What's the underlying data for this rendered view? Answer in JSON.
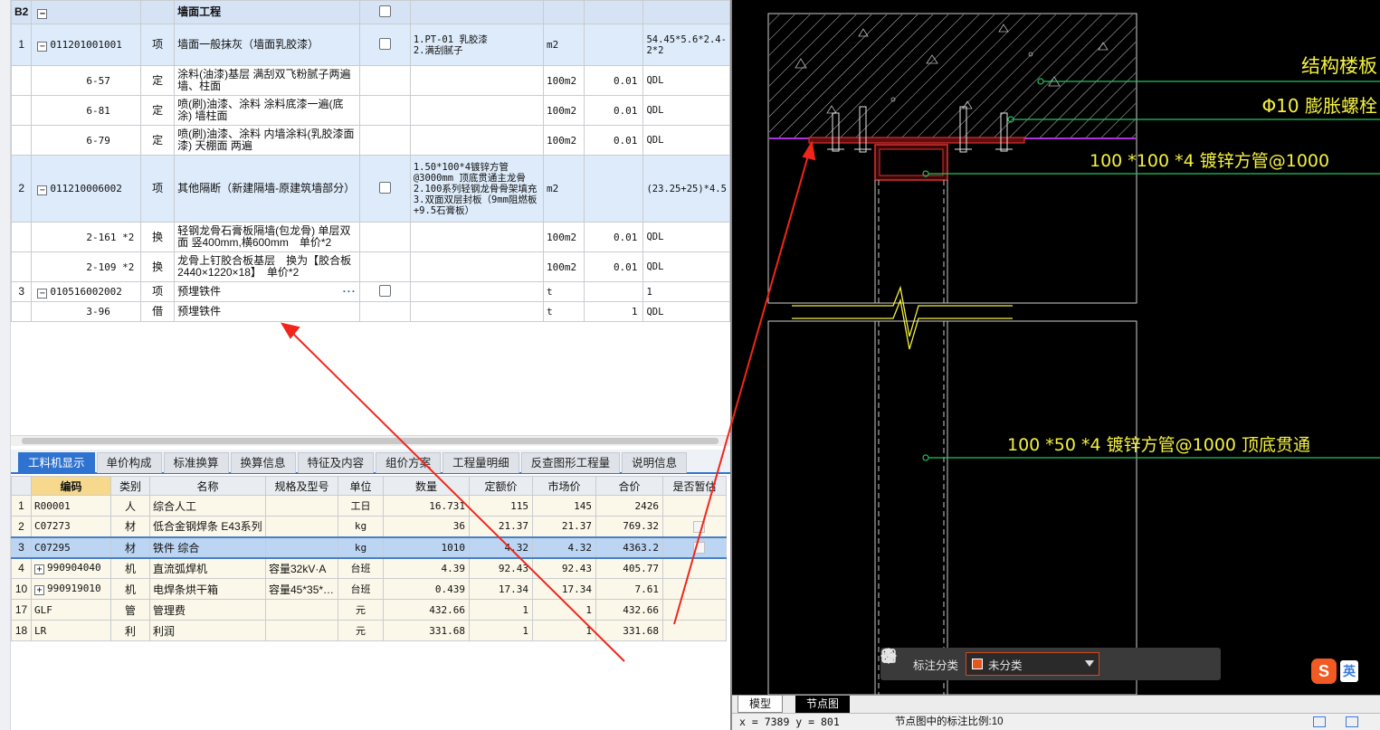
{
  "upper_table": {
    "rows": [
      {
        "kind": "section",
        "idx": "B2",
        "code": "",
        "type": "",
        "name": "墙面工程",
        "feature": "",
        "unit": "",
        "content": "",
        "qty": "",
        "checkbox": true
      },
      {
        "kind": "item",
        "idx": "1",
        "code": "011201001001",
        "type": "项",
        "name": "墙面一般抹灰（墙面乳胶漆）",
        "feature": "1.PT-01 乳胶漆\n2.满刮腻子",
        "unit": "m2",
        "content": "",
        "qty": "54.45*5.6*2.4-2*2",
        "checkbox": true
      },
      {
        "kind": "sub",
        "idx": "",
        "code": "6-57",
        "type": "定",
        "name": "涂料(油漆)基层 满刮双飞粉腻子两遍 墙、柱面",
        "feature": "",
        "unit": "100m2",
        "content": "0.01",
        "qty": "QDL",
        "checkbox": false
      },
      {
        "kind": "sub",
        "idx": "",
        "code": "6-81",
        "type": "定",
        "name": "喷(刷)油漆、涂料 涂料底漆一遍(底涂) 墙柱面",
        "feature": "",
        "unit": "100m2",
        "content": "0.01",
        "qty": "QDL",
        "checkbox": false
      },
      {
        "kind": "sub",
        "idx": "",
        "code": "6-79",
        "type": "定",
        "name": "喷(刷)油漆、涂料 内墙涂料(乳胶漆面漆) 天棚面 两遍",
        "feature": "",
        "unit": "100m2",
        "content": "0.01",
        "qty": "QDL",
        "checkbox": false
      },
      {
        "kind": "item",
        "idx": "2",
        "code": "011210006002",
        "type": "项",
        "name": "其他隔断（新建隔墙-原建筑墙部分）",
        "feature": "1.50*100*4镀锌方管@3000mm 顶底贯通主龙骨　2.100系列轻钢龙骨骨架填充\n3.双面双层封板（9mm阻燃板+9.5石膏板）",
        "unit": "m2",
        "content": "",
        "qty": "(23.25+25)*4.5",
        "checkbox": true
      },
      {
        "kind": "sub",
        "idx": "",
        "code": "2-161 *2",
        "type": "换",
        "name": "轻钢龙骨石膏板隔墙(包龙骨) 单层双面 竖400mm,横600mm　单价*2",
        "feature": "",
        "unit": "100m2",
        "content": "0.01",
        "qty": "QDL",
        "checkbox": false
      },
      {
        "kind": "sub",
        "idx": "",
        "code": "2-109 *2",
        "type": "换",
        "name": "龙骨上钉胶合板基层　换为【胶合板 2440×1220×18】　单价*2",
        "feature": "",
        "unit": "100m2",
        "content": "0.01",
        "qty": "QDL",
        "checkbox": false
      },
      {
        "kind": "selected",
        "idx": "3",
        "code": "010516002002",
        "type": "项",
        "name": "预埋铁件",
        "feature": "",
        "unit": "t",
        "content": "",
        "qty": "1",
        "checkbox": true,
        "dots": "···"
      },
      {
        "kind": "sub",
        "idx": "",
        "code": "3-96",
        "type": "借",
        "name": "预埋铁件",
        "feature": "",
        "unit": "t",
        "content": "1",
        "qty": "QDL",
        "checkbox": false
      }
    ]
  },
  "tabs": [
    "工料机显示",
    "单价构成",
    "标准换算",
    "换算信息",
    "特征及内容",
    "组价方案",
    "工程量明细",
    "反查图形工程量",
    "说明信息"
  ],
  "active_tab": 0,
  "resources": {
    "headers": [
      "编码",
      "类别",
      "名称",
      "规格及型号",
      "单位",
      "数量",
      "定额价",
      "市场价",
      "合价",
      "是否暂估"
    ],
    "rows": [
      {
        "idx": "1",
        "code": "R00001",
        "cat": "人",
        "name": "综合人工",
        "spec": "",
        "unit": "工日",
        "qty": "16.731",
        "base": "115",
        "market": "145",
        "total": "2426",
        "expand": false,
        "sel": false,
        "check": false
      },
      {
        "idx": "2",
        "code": "C07273",
        "cat": "材",
        "name": "低合金钢焊条 E43系列",
        "spec": "",
        "unit": "kg",
        "qty": "36",
        "base": "21.37",
        "market": "21.37",
        "total": "769.32",
        "expand": false,
        "sel": false,
        "check": true
      },
      {
        "idx": "3",
        "code": "C07295",
        "cat": "材",
        "name": "铁件 综合",
        "spec": "",
        "unit": "kg",
        "qty": "1010",
        "base": "4.32",
        "market": "4.32",
        "total": "4363.2",
        "expand": false,
        "sel": true,
        "check": true
      },
      {
        "idx": "4",
        "code": "990904040",
        "cat": "机",
        "name": "直流弧焊机",
        "spec": "容量32kV·A",
        "unit": "台班",
        "qty": "4.39",
        "base": "92.43",
        "market": "92.43",
        "total": "405.77",
        "expand": true,
        "sel": false,
        "check": false
      },
      {
        "idx": "10",
        "code": "990919010",
        "cat": "机",
        "name": "电焊条烘干箱",
        "spec": "容量45*35*…",
        "unit": "台班",
        "qty": "0.439",
        "base": "17.34",
        "market": "17.34",
        "total": "7.61",
        "expand": true,
        "sel": false,
        "check": false
      },
      {
        "idx": "17",
        "code": "GLF",
        "cat": "管",
        "name": "管理费",
        "spec": "",
        "unit": "元",
        "qty": "432.66",
        "base": "1",
        "market": "1",
        "total": "432.66",
        "expand": false,
        "sel": false,
        "check": false
      },
      {
        "idx": "18",
        "code": "LR",
        "cat": "利",
        "name": "利润",
        "spec": "",
        "unit": "元",
        "qty": "331.68",
        "base": "1",
        "market": "1",
        "total": "331.68",
        "expand": false,
        "sel": false,
        "check": false
      }
    ]
  },
  "cad": {
    "labels": {
      "slab": "结构楼板",
      "bolt": "Φ10 膨胀螺栓",
      "tube1": "100 *100 *4 镀锌方管@1000",
      "tube2": "100 *50 *4 镀锌方管@1000 顶底贯通"
    },
    "toolbar": {
      "label": "标注分类",
      "category": "未分类"
    },
    "ime": {
      "logo": "S",
      "mode": "英"
    },
    "layout_tabs": [
      "模型",
      "节点图"
    ],
    "status": {
      "coord": "x = 7389  y = 801",
      "scale": "节点图中的标注比例:10"
    },
    "colors": {
      "label": "#f4f140",
      "leader": "#22c55e",
      "arrow": "#f0261c"
    }
  }
}
